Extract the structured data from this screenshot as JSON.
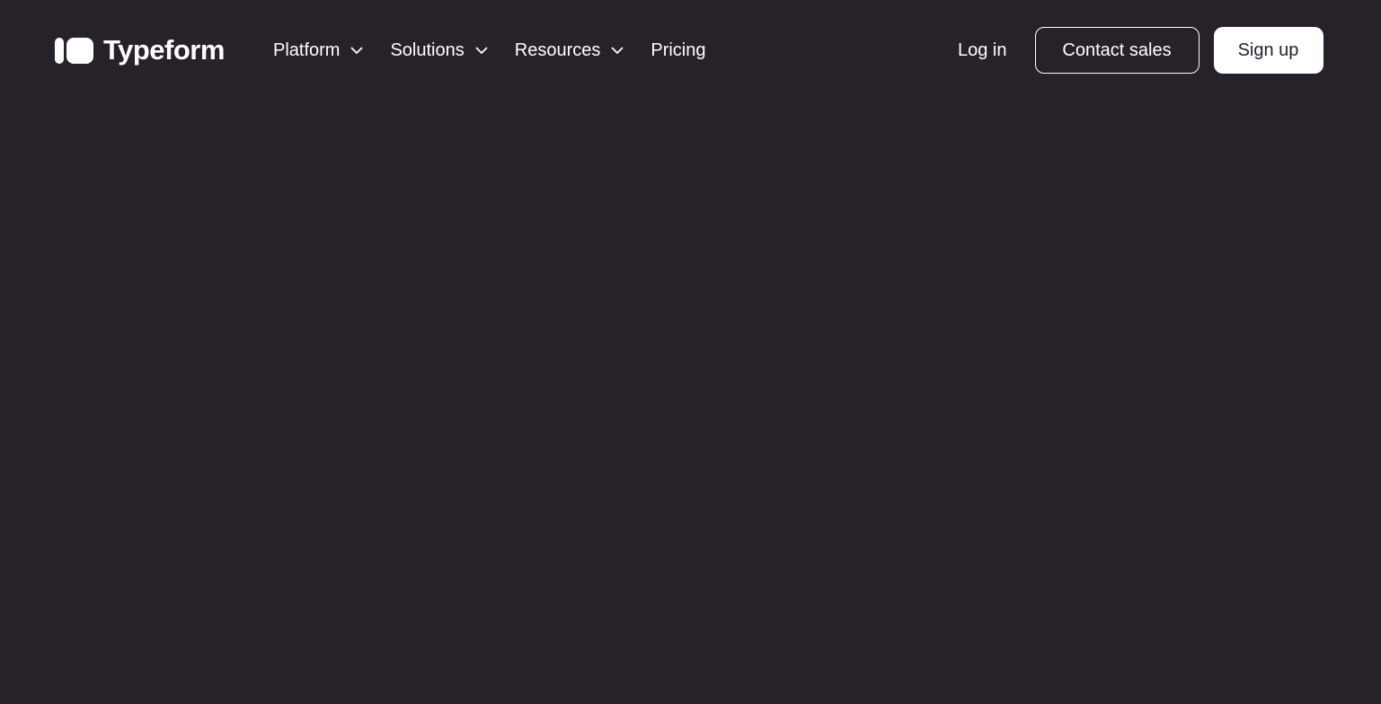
{
  "brand": {
    "name": "Typeform",
    "logo_icon": "typeform-logo-icon"
  },
  "nav": {
    "items": [
      {
        "label": "Platform",
        "has_dropdown": true,
        "icon": "chevron-down-icon"
      },
      {
        "label": "Solutions",
        "has_dropdown": true,
        "icon": "chevron-down-icon"
      },
      {
        "label": "Resources",
        "has_dropdown": true,
        "icon": "chevron-down-icon"
      },
      {
        "label": "Pricing",
        "has_dropdown": false
      }
    ]
  },
  "actions": {
    "login_label": "Log in",
    "contact_sales_label": "Contact sales",
    "sign_up_label": "Sign up"
  },
  "colors": {
    "background": "#27212a",
    "foreground": "#ffffff"
  }
}
